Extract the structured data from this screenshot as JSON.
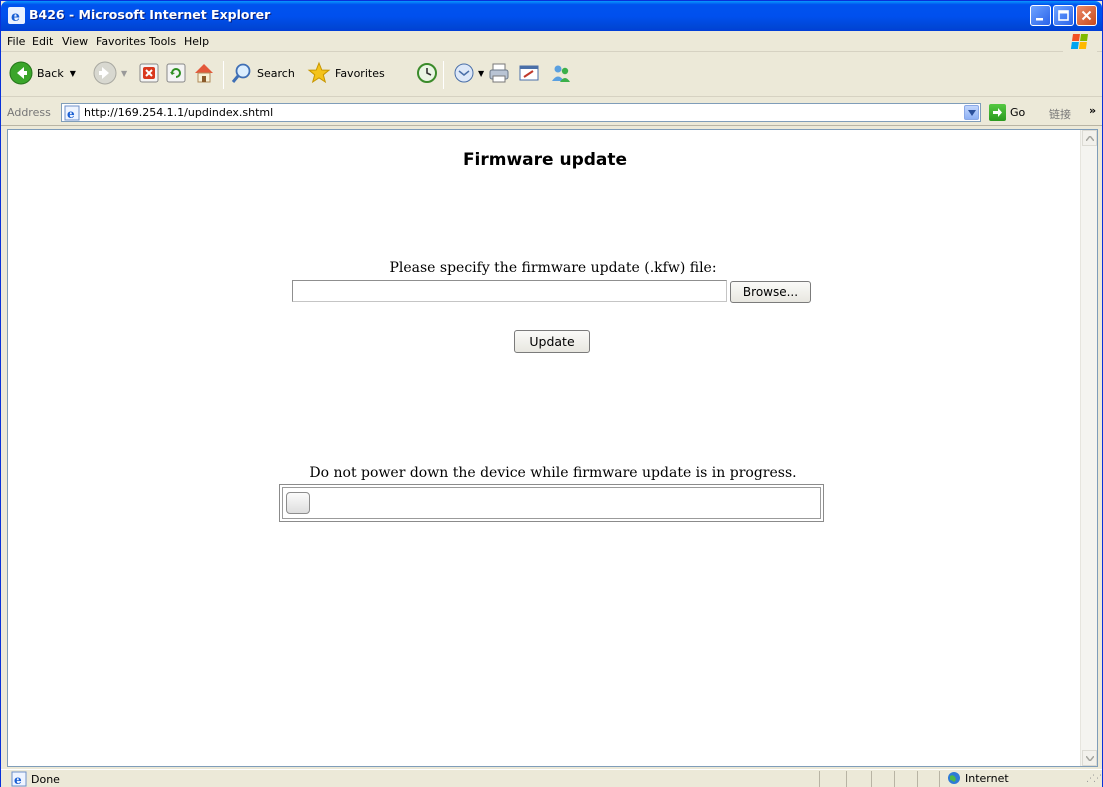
{
  "window": {
    "title": "B426 - Microsoft Internet Explorer"
  },
  "menu": [
    "File",
    "Edit",
    "View",
    "Favorites",
    "Tools",
    "Help"
  ],
  "toolbar": {
    "back_label": "Back",
    "search_label": "Search",
    "favorites_label": "Favorites"
  },
  "address": {
    "label": "Address",
    "url": "http://169.254.1.1/updindex.shtml",
    "go_label": "Go",
    "links_label": "链接",
    "links_chevron": "»"
  },
  "page": {
    "title": "Firmware update",
    "specify_label": "Please specify the firmware update (.kfw) file:",
    "file_value": "",
    "browse_label": "Browse...",
    "update_label": "Update",
    "warning_text": "Do not power down the device while firmware update is in progress.",
    "progress_percent": 0
  },
  "status": {
    "text": "Done",
    "zone": "Internet"
  },
  "colors": {
    "titlebar": "#0053ee",
    "chrome": "#ece9d8",
    "content_bg": "#ffffff",
    "address_border": "#7f9db9"
  }
}
